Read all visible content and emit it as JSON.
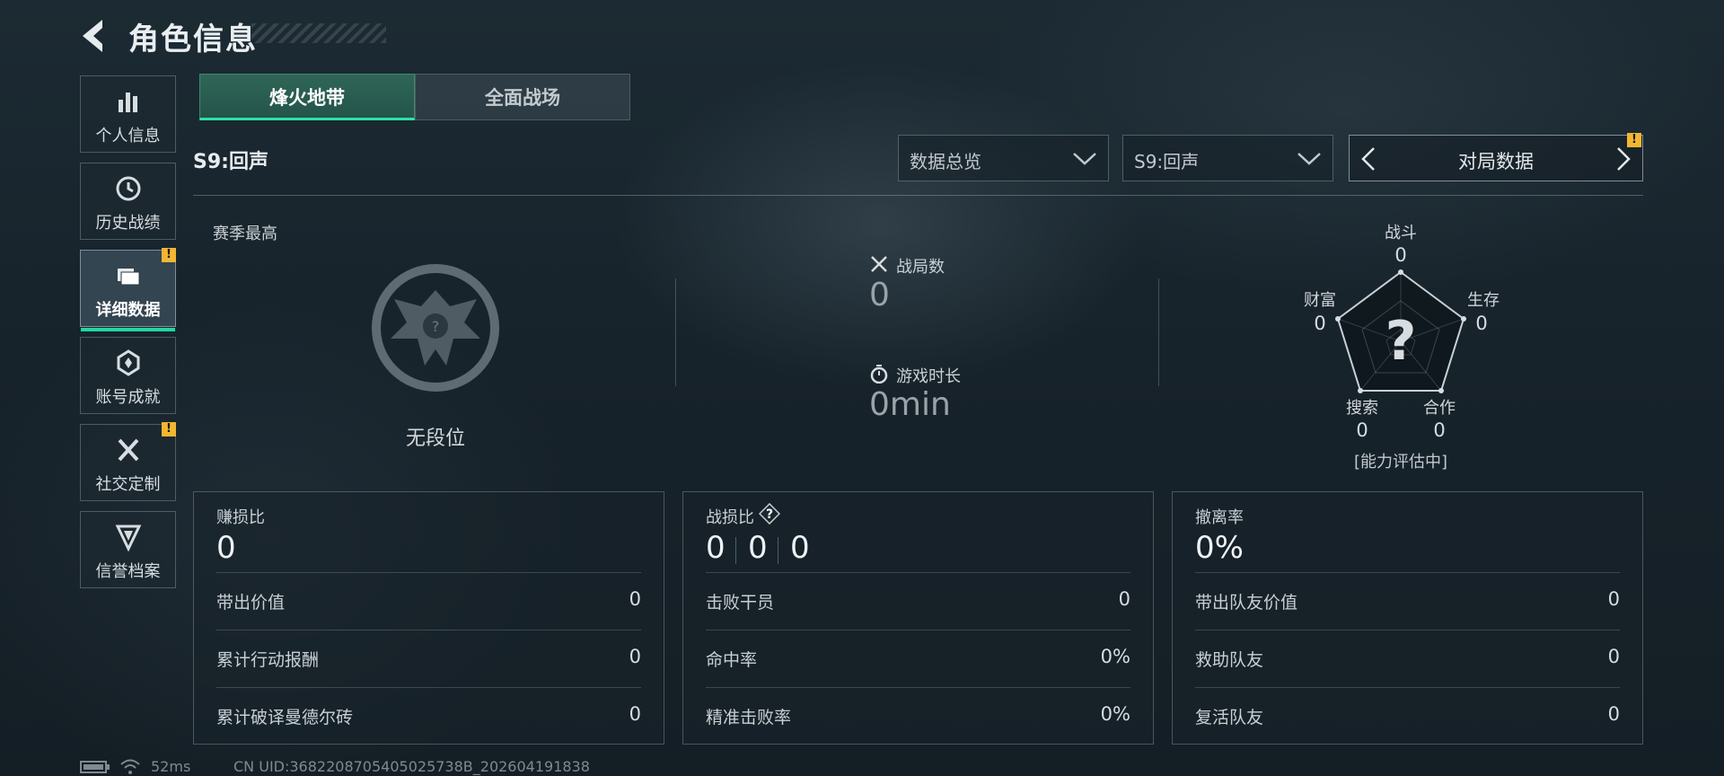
{
  "header": {
    "title": "角色信息"
  },
  "sidebar": {
    "items": [
      {
        "label": "个人信息",
        "icon": "bar-chart-icon"
      },
      {
        "label": "历史战绩",
        "icon": "history-icon"
      },
      {
        "label": "详细数据",
        "icon": "folder-icon",
        "active": true,
        "badge": "!"
      },
      {
        "label": "账号成就",
        "icon": "medal-icon"
      },
      {
        "label": "社交定制",
        "icon": "tools-icon",
        "badge": "!"
      },
      {
        "label": "信誉档案",
        "icon": "credit-icon"
      }
    ]
  },
  "tabs": [
    {
      "label": "烽火地带",
      "active": true
    },
    {
      "label": "全面战场",
      "active": false
    }
  ],
  "season_title": "S9:回声",
  "filters": {
    "overview": "数据总览",
    "season": "S9:回声",
    "match_data": "对局数据",
    "match_badge": "!"
  },
  "rank": {
    "heading": "赛季最高",
    "name": "无段位"
  },
  "stats": {
    "matches_label": "战局数",
    "matches_value": "0",
    "playtime_label": "游戏时长",
    "playtime_value": "0min"
  },
  "radar": {
    "center": "?",
    "note": "[能力评估中]",
    "axes": [
      {
        "label": "战斗",
        "value": "0"
      },
      {
        "label": "生存",
        "value": "0"
      },
      {
        "label": "合作",
        "value": "0"
      },
      {
        "label": "搜索",
        "value": "0"
      },
      {
        "label": "财富",
        "value": "0"
      }
    ]
  },
  "cards": [
    {
      "title": "赚损比",
      "big": "0",
      "rows": [
        {
          "label": "带出价值",
          "value": "0"
        },
        {
          "label": "累计行动报酬",
          "value": "0"
        },
        {
          "label": "累计破译曼德尔砖",
          "value": "0"
        }
      ]
    },
    {
      "title": "战损比",
      "help": "?",
      "big_parts": [
        "0",
        "0",
        "0"
      ],
      "rows": [
        {
          "label": "击败干员",
          "value": "0"
        },
        {
          "label": "命中率",
          "value": "0%"
        },
        {
          "label": "精准击败率",
          "value": "0%"
        }
      ]
    },
    {
      "title": "撤离率",
      "big": "0%",
      "rows": [
        {
          "label": "带出队友价值",
          "value": "0"
        },
        {
          "label": "救助队友",
          "value": "0"
        },
        {
          "label": "复活队友",
          "value": "0"
        }
      ]
    }
  ],
  "footer": {
    "ping": "52ms",
    "uid": "CN UID:3682208705405025738B_202604191838"
  },
  "colors": {
    "accent": "#2ee0a6",
    "badge": "#f2b632"
  }
}
